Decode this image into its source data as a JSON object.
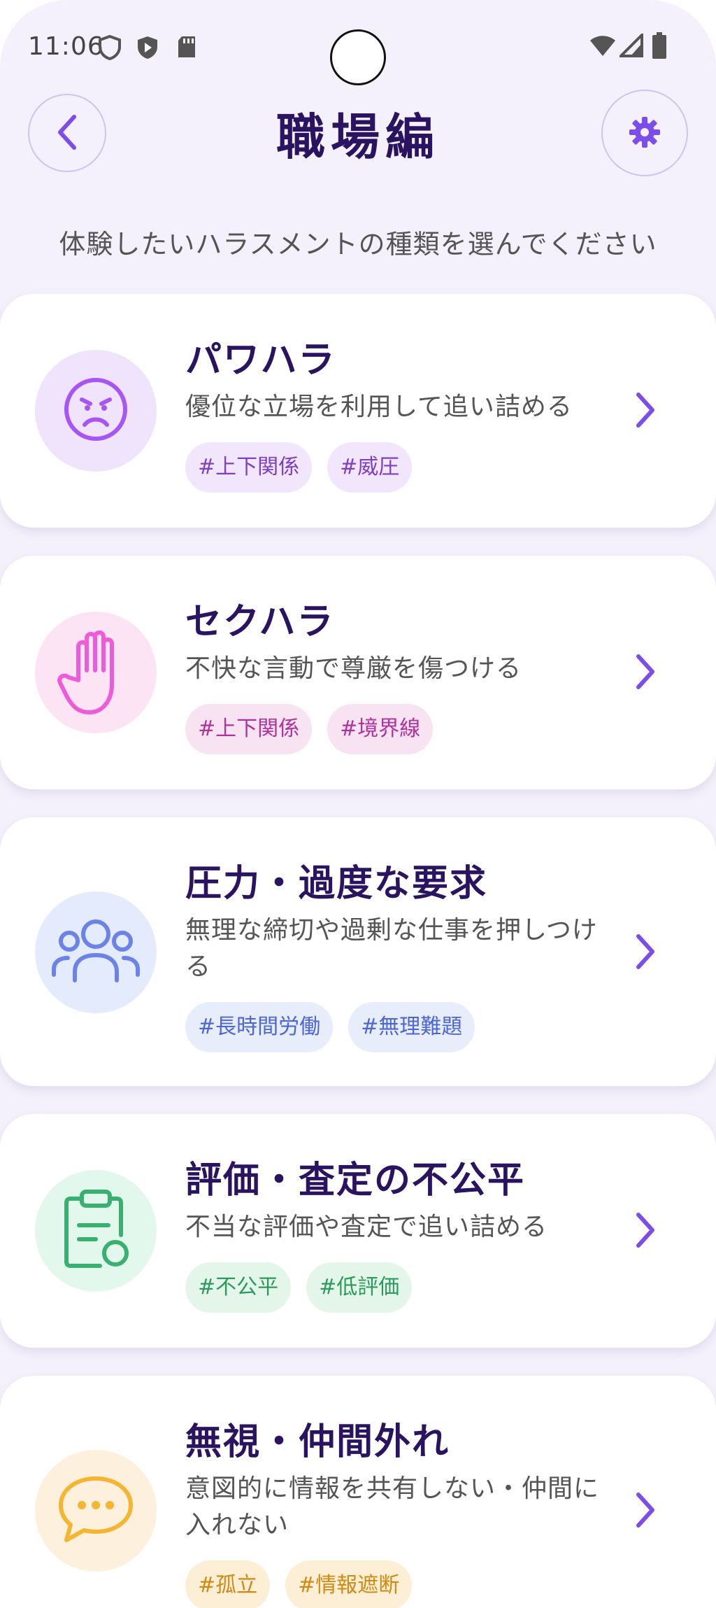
{
  "status_bar": {
    "time": "11:06"
  },
  "header": {
    "title": "職場編",
    "subtitle": "体験したいハラスメントの種類を選んでください"
  },
  "cards": [
    {
      "title": "パワハラ",
      "description": "優位な立場を利用して追い詰める",
      "icon": "angry-face-icon",
      "tags": [
        "#上下関係",
        "#威圧"
      ],
      "accent": "#a855f7",
      "icon_bg": "#efe4fc",
      "tag_bg": "#f1e6fc",
      "tag_color": "#7e3fc4"
    },
    {
      "title": "セクハラ",
      "description": "不快な言動で尊厳を傷つける",
      "icon": "raised-hand-icon",
      "tags": [
        "#上下関係",
        "#境界線"
      ],
      "accent": "#e25ad8",
      "icon_bg": "#fde4f4",
      "tag_bg": "#f7e3f1",
      "tag_color": "#b0329e"
    },
    {
      "title": "圧力・過度な要求",
      "description": "無理な締切や過剰な仕事を押しつける",
      "icon": "users-group-icon",
      "tags": [
        "#長時間労働",
        "#無理難題"
      ],
      "accent": "#6b83e6",
      "icon_bg": "#e4ebfd",
      "tag_bg": "#e8edfc",
      "tag_color": "#4d66d6"
    },
    {
      "title": "評価・査定の不公平",
      "description": "不当な評価や査定で追い詰める",
      "icon": "clipboard-icon",
      "tags": [
        "#不公平",
        "#低評価"
      ],
      "accent": "#3ab070",
      "icon_bg": "#e3f8ec",
      "tag_bg": "#e4f6ea",
      "tag_color": "#2b9a5c"
    },
    {
      "title": "無視・仲間外れ",
      "description": "意図的に情報を共有しない・仲間に入れない",
      "icon": "chat-bubble-icon",
      "tags": [
        "#孤立",
        "#情報遮断"
      ],
      "accent": "#f5b530",
      "icon_bg": "#fdf0dc",
      "tag_bg": "#fdeed6",
      "tag_color": "#d08a12"
    }
  ],
  "colors": {
    "background": "#f4f1fc",
    "title": "#2a1360",
    "chevron": "#7c4dea"
  }
}
